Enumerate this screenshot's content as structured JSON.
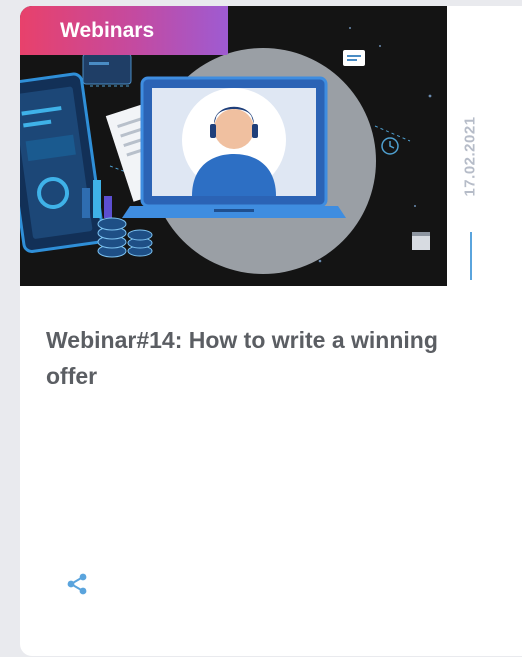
{
  "card": {
    "category": "Webinars",
    "date": "17.02.2021",
    "title": "Webinar#14: How to write a winning offer"
  },
  "icons": {
    "share": "share-icon"
  },
  "colors": {
    "badge_start": "#e8416b",
    "badge_end": "#9e5bd2",
    "accent": "#5aa4dd",
    "title_text": "#5b5e63",
    "date_text": "#b6bcc8",
    "image_background": "#141414"
  }
}
